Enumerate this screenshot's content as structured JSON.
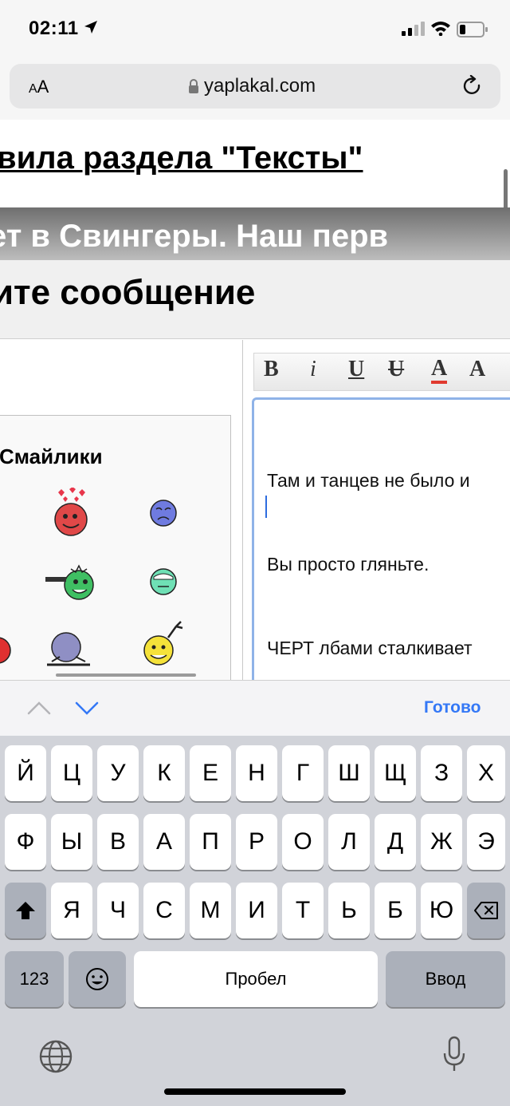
{
  "status_bar": {
    "time": "02:11"
  },
  "address_bar": {
    "aa_label_small": "A",
    "aa_label_big": "A",
    "url": "yaplakal.com"
  },
  "page": {
    "rules_title": "вила раздела \"Тексты\"",
    "topic_title": "ет в Свингеры. Наш перв",
    "reply_title": "ите сообщение",
    "smiley_panel_label": "Смайлики",
    "editor_toolbar": [
      "B",
      "i",
      "U",
      "U",
      "A",
      "A"
    ],
    "editor_text_lines": [
      "Там и танцев не было и",
      "Вы просто гляньте.",
      "ЧЕРТ лбами сталкивает"
    ]
  },
  "accessory_bar": {
    "done_label": "Готово"
  },
  "keyboard": {
    "row1": [
      "Й",
      "Ц",
      "У",
      "К",
      "Е",
      "Н",
      "Г",
      "Ш",
      "Щ",
      "З",
      "Х"
    ],
    "row2": [
      "Ф",
      "Ы",
      "В",
      "А",
      "П",
      "Р",
      "О",
      "Л",
      "Д",
      "Ж",
      "Э"
    ],
    "row3": [
      "Я",
      "Ч",
      "С",
      "М",
      "И",
      "Т",
      "Ь",
      "Б",
      "Ю"
    ],
    "numbers_label": "123",
    "space_label": "Пробел",
    "return_label": "Ввод"
  }
}
